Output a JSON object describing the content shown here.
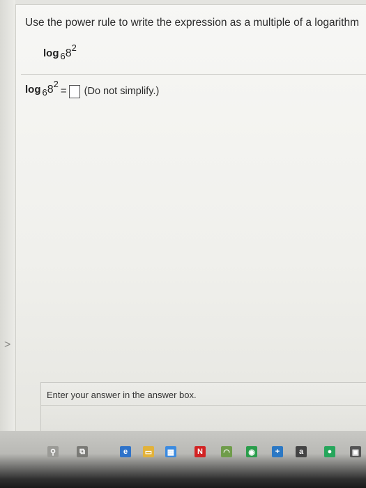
{
  "question": {
    "prompt": "Use the power rule to write the expression as a multiple of a logarithm",
    "expression": {
      "func": "log",
      "log_base": "6",
      "arg": "8",
      "exponent": "2"
    }
  },
  "answer": {
    "equals": "=",
    "value": "",
    "note": "(Do not simplify.)"
  },
  "help": {
    "text": "Enter your answer in the answer box."
  },
  "nav": {
    "chevron": ">"
  },
  "taskbar": {
    "icons": [
      {
        "name": "taskview-icon",
        "glyph": "⧉",
        "color": "#7a7a76"
      },
      {
        "name": "edge-icon",
        "glyph": "e",
        "color": "#2f73c9"
      },
      {
        "name": "explorer-icon",
        "glyph": "▭",
        "color": "#e2b23a"
      },
      {
        "name": "store-icon",
        "glyph": "▦",
        "color": "#3c8be0"
      },
      {
        "name": "netflix-icon",
        "glyph": "N",
        "color": "#d22323"
      },
      {
        "name": "speed-icon",
        "glyph": "◠",
        "color": "#6f9c4a"
      },
      {
        "name": "chrome-icon",
        "glyph": "◉",
        "color": "#2a9d4b"
      },
      {
        "name": "plus-icon",
        "glyph": "+",
        "color": "#2b78c4"
      },
      {
        "name": "amazon-icon",
        "glyph": "a",
        "color": "#444444"
      },
      {
        "name": "green-app-icon",
        "glyph": "●",
        "color": "#26a65b"
      },
      {
        "name": "photo-icon",
        "glyph": "▣",
        "color": "#555555"
      }
    ]
  }
}
